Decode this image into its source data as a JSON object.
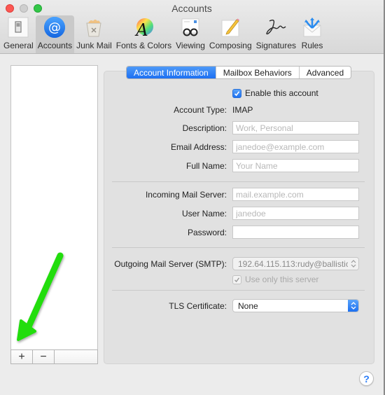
{
  "window": {
    "title": "Accounts"
  },
  "toolbar": {
    "items": [
      {
        "label": "General",
        "icon": "general-switch-icon",
        "active": false
      },
      {
        "label": "Accounts",
        "icon": "at-sign-icon",
        "active": true
      },
      {
        "label": "Junk Mail",
        "icon": "trash-bin-icon",
        "active": false
      },
      {
        "label": "Fonts & Colors",
        "icon": "font-color-wheel-icon",
        "active": false
      },
      {
        "label": "Viewing",
        "icon": "glasses-icon",
        "active": false
      },
      {
        "label": "Composing",
        "icon": "pencil-icon",
        "active": false
      },
      {
        "label": "Signatures",
        "icon": "signature-icon",
        "active": false
      },
      {
        "label": "Rules",
        "icon": "envelope-arrows-icon",
        "active": false
      }
    ]
  },
  "account_list": {
    "items": [],
    "add_label": "+",
    "remove_label": "−"
  },
  "tabs": [
    {
      "label": "Account Information",
      "active": true
    },
    {
      "label": "Mailbox Behaviors",
      "active": false
    },
    {
      "label": "Advanced",
      "active": false
    }
  ],
  "form": {
    "enable_account": {
      "label": "Enable this account",
      "checked": true
    },
    "account_type": {
      "label": "Account Type:",
      "value": "IMAP"
    },
    "description": {
      "label": "Description:",
      "value": "",
      "placeholder": "Work, Personal"
    },
    "email": {
      "label": "Email Address:",
      "value": "",
      "placeholder": "janedoe@example.com"
    },
    "full_name": {
      "label": "Full Name:",
      "value": "",
      "placeholder": "Your Name"
    },
    "incoming_server": {
      "label": "Incoming Mail Server:",
      "value": "",
      "placeholder": "mail.example.com"
    },
    "user_name": {
      "label": "User Name:",
      "value": "",
      "placeholder": "janedoe"
    },
    "password": {
      "label": "Password:",
      "value": "",
      "placeholder": ""
    },
    "outgoing_server": {
      "label": "Outgoing Mail Server (SMTP):",
      "value": "192.64.115.113:rudy@ballistic",
      "disabled": true
    },
    "use_only_server": {
      "label": "Use only this server",
      "checked": true,
      "disabled": true
    },
    "tls_certificate": {
      "label": "TLS Certificate:",
      "value": "None"
    }
  },
  "help": {
    "label": "?"
  },
  "annotation": {
    "type": "green-arrow",
    "color": "#22dd11",
    "points_to": "add-account-button"
  },
  "colors": {
    "accent": "#1d70f0",
    "traffic_close": "#fc5753",
    "traffic_min": "#cfcfcf",
    "traffic_max": "#33c748"
  }
}
